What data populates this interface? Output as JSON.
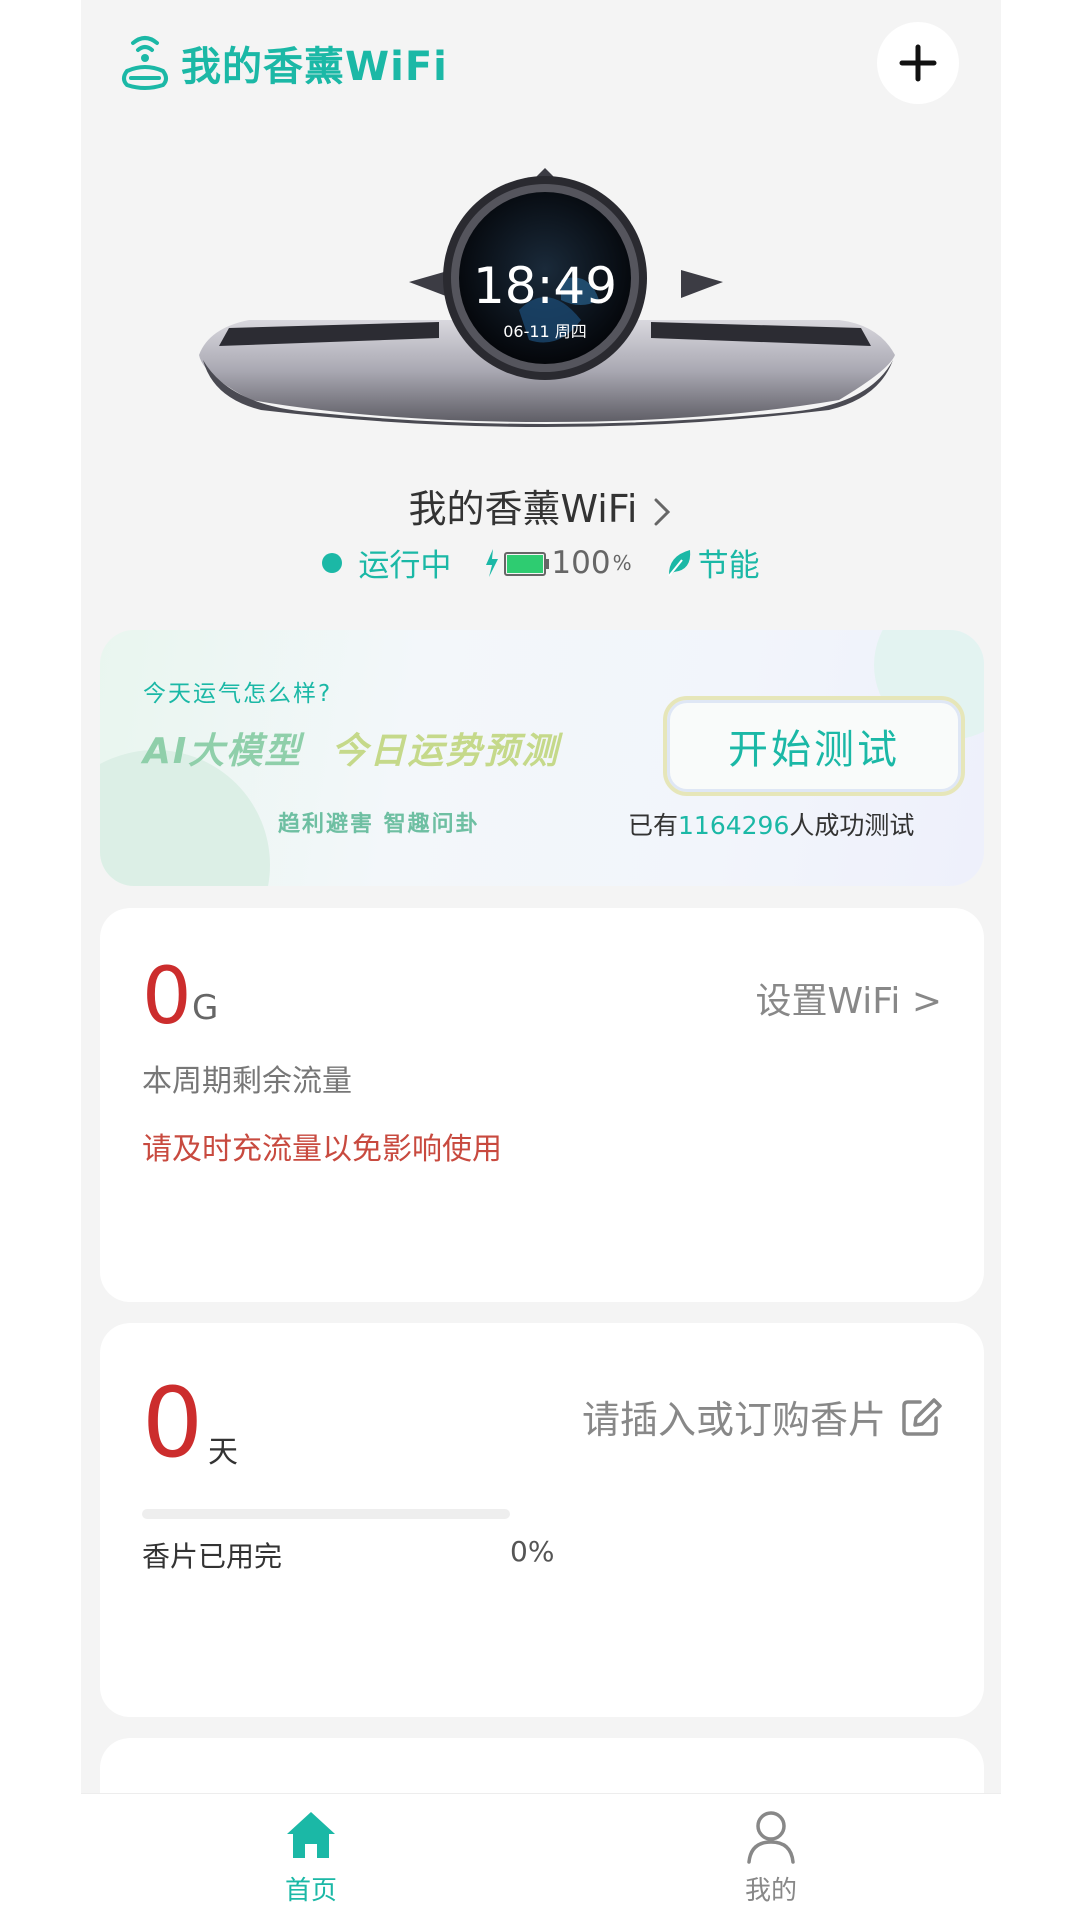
{
  "header": {
    "title": "我的香薰WiFi"
  },
  "device": {
    "screen_time": "18:49",
    "screen_date": "06-11 周四",
    "name": "我的香薰WiFi"
  },
  "status": {
    "running": "运行中",
    "battery_value": "100",
    "battery_unit": "%",
    "battery_level": 1.0,
    "eco": "节能"
  },
  "promo": {
    "question": "今天运气怎么样?",
    "headline_a": "AI大模型",
    "headline_b": "今日运势预测",
    "subtitle": "趋利避害 智趣问卦",
    "button": "开始测试",
    "count_prefix": "已有",
    "count_number": "1164296",
    "count_suffix": "人成功测试"
  },
  "traffic_card": {
    "value": "0",
    "unit": "G",
    "action": "设置WiFi >",
    "label": "本周期剩余流量",
    "warning": "请及时充流量以免影响使用"
  },
  "scent_card": {
    "value": "0",
    "unit": "天",
    "action": "请插入或订购香片",
    "progress": 0,
    "label": "香片已用完",
    "percent": "0%"
  },
  "tabbar": {
    "home": "首页",
    "me": "我的"
  },
  "colors": {
    "accent": "#1bb8a6",
    "warning": "#c84a3f",
    "value_red": "#cc2d2d"
  }
}
